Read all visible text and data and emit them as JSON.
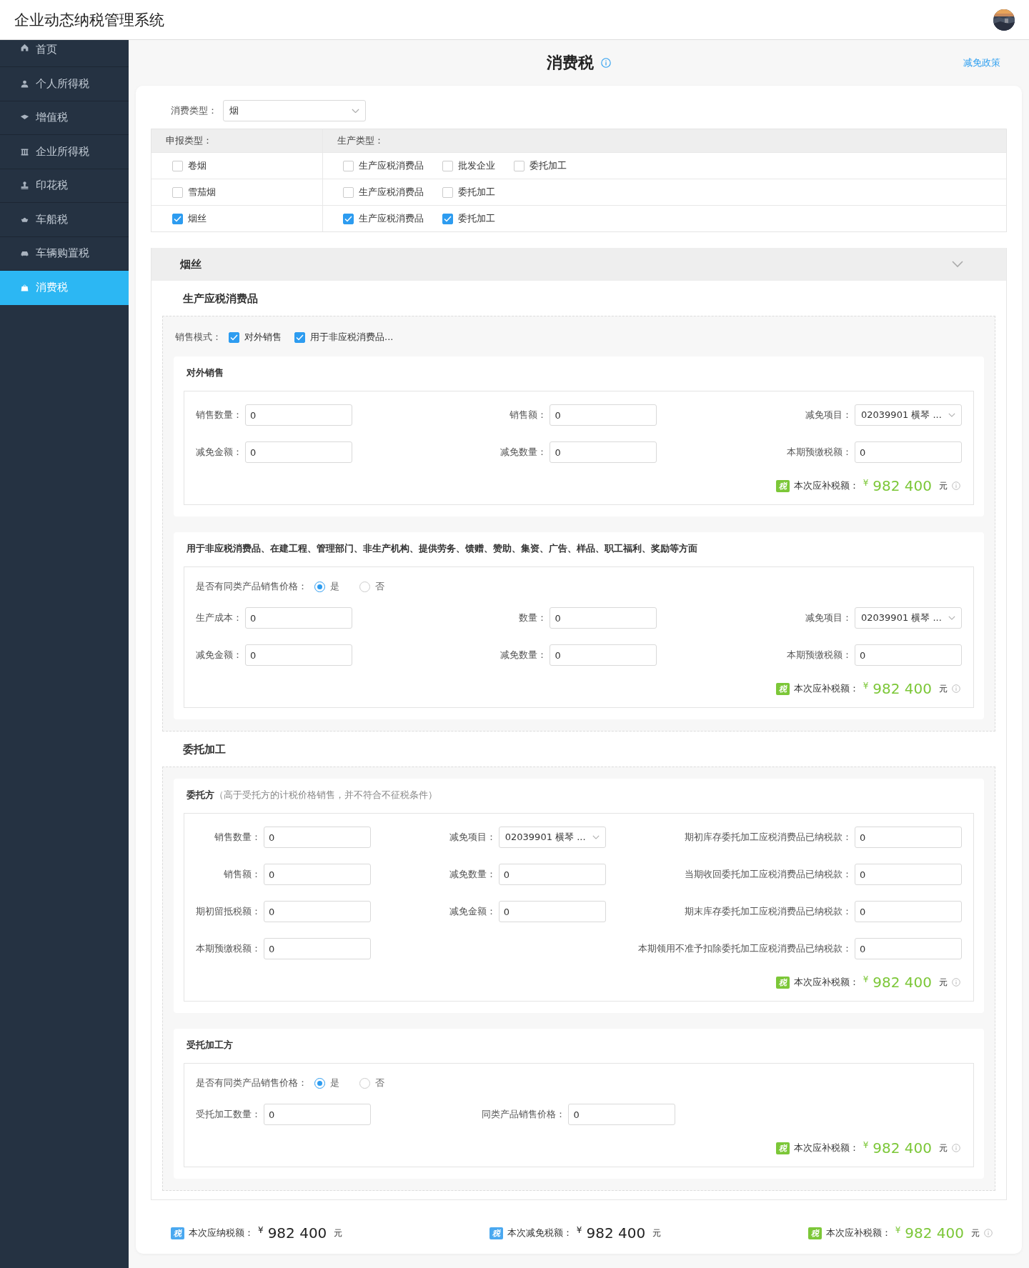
{
  "header": {
    "title": "企业动态纳税管理系统"
  },
  "sidebar": {
    "items": [
      {
        "label": "首页",
        "selected": false
      },
      {
        "label": "个人所得税",
        "selected": false
      },
      {
        "label": "增值税",
        "selected": false
      },
      {
        "label": "企业所得税",
        "selected": false
      },
      {
        "label": "印花税",
        "selected": false
      },
      {
        "label": "车船税",
        "selected": false
      },
      {
        "label": "车辆购置税",
        "selected": false
      },
      {
        "label": "消费税",
        "selected": true
      }
    ]
  },
  "page": {
    "title": "消费税",
    "link": "减免政策"
  },
  "consumption_type": {
    "label": "消费类型：",
    "value": "烟"
  },
  "declaration_table": {
    "columns": [
      "申报类型：",
      "生产类型："
    ],
    "rows": [
      {
        "declare": {
          "label": "卷烟",
          "checked": false
        },
        "production": [
          {
            "label": "生产应税消费品",
            "checked": false
          },
          {
            "label": "批发企业",
            "checked": false
          },
          {
            "label": "委托加工",
            "checked": false
          }
        ]
      },
      {
        "declare": {
          "label": "雪茄烟",
          "checked": false
        },
        "production": [
          {
            "label": "生产应税消费品",
            "checked": false
          },
          {
            "label": "委托加工",
            "checked": false
          }
        ]
      },
      {
        "declare": {
          "label": "烟丝",
          "checked": true
        },
        "production": [
          {
            "label": "生产应税消费品",
            "checked": true
          },
          {
            "label": "委托加工",
            "checked": true
          }
        ]
      }
    ]
  },
  "panel": {
    "title": "烟丝",
    "expanded": true,
    "sections": [
      {
        "title": "生产应税消费品",
        "sale_mode": {
          "label": "销售模式：",
          "options": [
            {
              "label": "对外销售",
              "checked": true
            },
            {
              "label": "用于非应税消费品...",
              "checked": true
            }
          ]
        },
        "cards": [
          {
            "title": "对外销售",
            "columns": [
              [
                {
                  "label": "销售数量：",
                  "value": "0",
                  "kind": "input"
                },
                {
                  "label": "减免金额：",
                  "value": "0",
                  "kind": "input"
                }
              ],
              [
                {
                  "label": "销售额：",
                  "value": "0",
                  "kind": "input"
                },
                {
                  "label": "减免数量：",
                  "value": "0",
                  "kind": "input"
                }
              ],
              [
                {
                  "label": "减免项目：",
                  "value": "02039901 横琴 ...",
                  "kind": "select"
                },
                {
                  "label": "本期预缴税额：",
                  "value": "0",
                  "kind": "input"
                }
              ]
            ],
            "result": {
              "badge": "税",
              "label": "本次应补税额：",
              "currency": "¥",
              "amount": "982 400",
              "unit": "元"
            }
          },
          {
            "title": "用于非应税消费品、在建工程、管理部门、非生产机构、提供劳务、馈赠、赞助、集资、广告、样品、职工福利、奖励等方面",
            "radio": {
              "label": "是否有同类产品销售价格：",
              "options": [
                {
                  "label": "是",
                  "selected": true
                },
                {
                  "label": "否",
                  "selected": false
                }
              ]
            },
            "columns": [
              [
                {
                  "label": "生产成本：",
                  "value": "0",
                  "kind": "input"
                },
                {
                  "label": "减免金额：",
                  "value": "0",
                  "kind": "input"
                }
              ],
              [
                {
                  "label": "数量：",
                  "value": "0",
                  "kind": "input"
                },
                {
                  "label": "减免数量：",
                  "value": "0",
                  "kind": "input"
                }
              ],
              [
                {
                  "label": "减免项目：",
                  "value": "02039901 横琴 ...",
                  "kind": "select"
                },
                {
                  "label": "本期预缴税额：",
                  "value": "0",
                  "kind": "input"
                }
              ]
            ],
            "result": {
              "badge": "税",
              "label": "本次应补税额：",
              "currency": "¥",
              "amount": "982 400",
              "unit": "元"
            }
          }
        ]
      },
      {
        "title": "委托加工",
        "cards": [
          {
            "title": "委托方",
            "note": "（高于受托方的计税价格销售，并不符合不征税条件）",
            "columns": [
              [
                {
                  "label": "销售数量：",
                  "value": "0",
                  "kind": "input"
                },
                {
                  "label": "销售额：",
                  "value": "0",
                  "kind": "input"
                },
                {
                  "label": "期初留抵税额：",
                  "value": "0",
                  "kind": "input"
                },
                {
                  "label": "本期预缴税额：",
                  "value": "0",
                  "kind": "input"
                }
              ],
              [
                {
                  "label": "减免项目：",
                  "value": "02039901 横琴 ...",
                  "kind": "select"
                },
                {
                  "label": "减免数量：",
                  "value": "0",
                  "kind": "input"
                },
                {
                  "label": "减免金额：",
                  "value": "0",
                  "kind": "input"
                }
              ],
              [
                {
                  "label": "期初库存委托加工应税消费品已纳税款：",
                  "value": "0",
                  "kind": "input"
                },
                {
                  "label": "当期收回委托加工应税消费品已纳税款：",
                  "value": "0",
                  "kind": "input"
                },
                {
                  "label": "期末库存委托加工应税消费品已纳税款：",
                  "value": "0",
                  "kind": "input"
                },
                {
                  "label": "本期领用不准予扣除委托加工应税消费品已纳税款：",
                  "value": "0",
                  "kind": "input"
                }
              ]
            ],
            "result": {
              "badge": "税",
              "label": "本次应补税额：",
              "currency": "¥",
              "amount": "982 400",
              "unit": "元"
            }
          },
          {
            "title": "受托加工方",
            "radio": {
              "label": "是否有同类产品销售价格：",
              "options": [
                {
                  "label": "是",
                  "selected": true
                },
                {
                  "label": "否",
                  "selected": false
                }
              ]
            },
            "columns": [
              [
                {
                  "label": "受托加工数量：",
                  "value": "0",
                  "kind": "input"
                }
              ],
              [
                {
                  "label": "同类产品销售价格：",
                  "value": "0",
                  "kind": "input"
                }
              ]
            ],
            "result": {
              "badge": "税",
              "label": "本次应补税额：",
              "currency": "¥",
              "amount": "982 400",
              "unit": "元"
            }
          }
        ]
      }
    ]
  },
  "totals": [
    {
      "kind": "plain",
      "badge": "税",
      "label": "本次应纳税额：",
      "currency": "¥",
      "amount": "982 400",
      "unit": "元"
    },
    {
      "kind": "plain",
      "badge": "税",
      "label": "本次减免税额：",
      "currency": "¥",
      "amount": "982 400",
      "unit": "元"
    },
    {
      "kind": "supplement",
      "badge": "税",
      "label": "本次应补税额：",
      "currency": "¥",
      "amount": "982 400",
      "unit": "元"
    }
  ]
}
